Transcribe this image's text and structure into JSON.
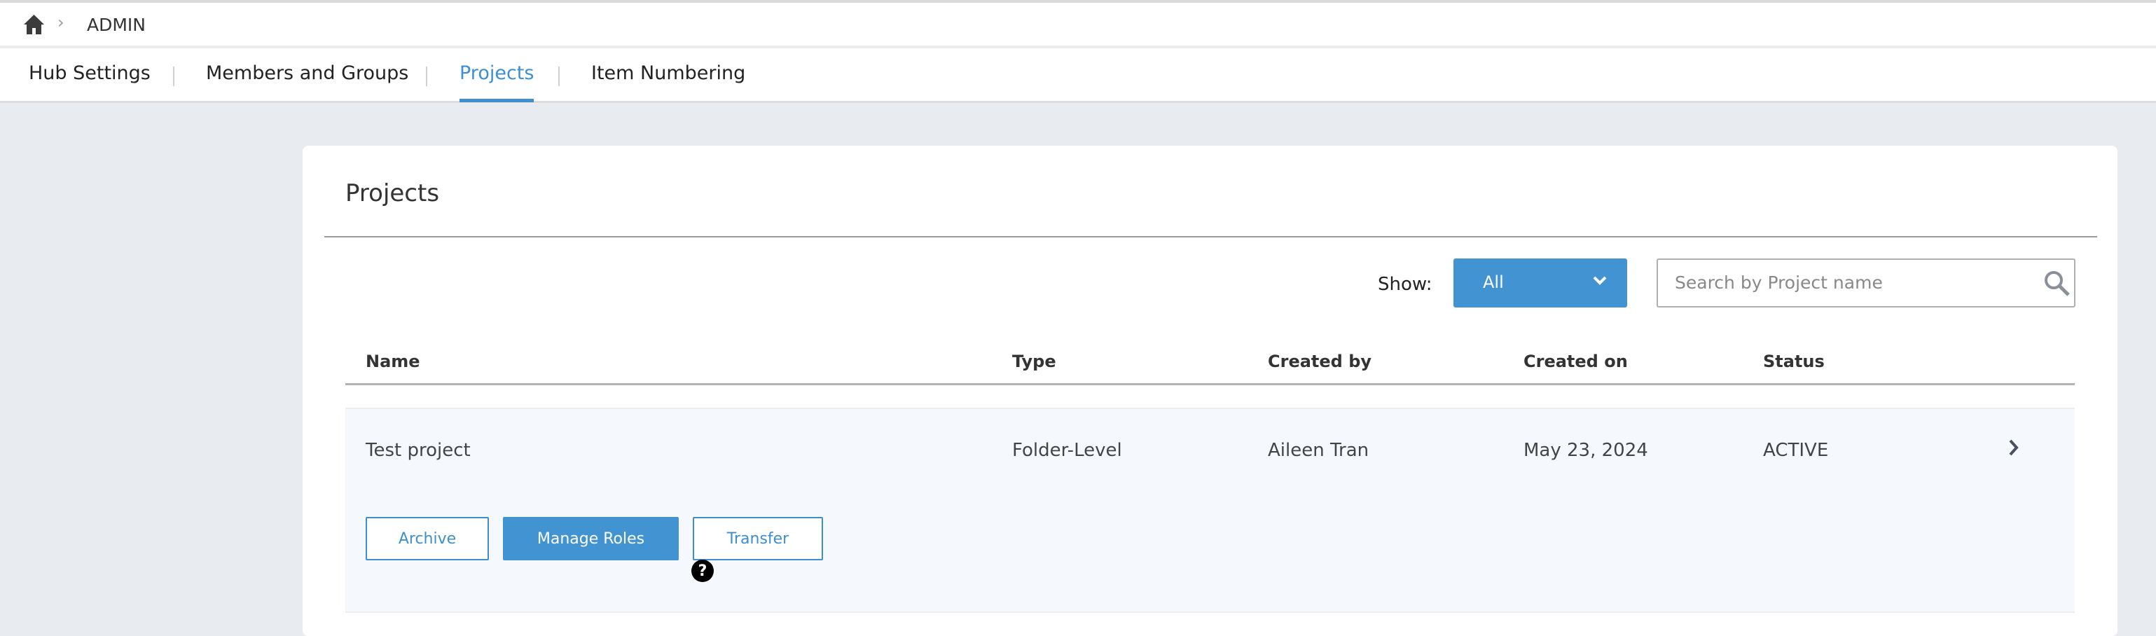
{
  "breadcrumb": {
    "home_icon": "home-icon",
    "label": "ADMIN"
  },
  "tabs": [
    {
      "label": "Hub Settings"
    },
    {
      "label": "Members and Groups"
    },
    {
      "label": "Projects",
      "active": true
    },
    {
      "label": "Item Numbering"
    }
  ],
  "page": {
    "title": "Projects",
    "show_label": "Show:",
    "show_value": "All",
    "search_placeholder": "Search by Project name"
  },
  "table": {
    "headers": [
      "Name",
      "Type",
      "Created by",
      "Created on",
      "Status"
    ],
    "rows": [
      {
        "name": "Test project",
        "type": "Folder-Level",
        "created_by": "Aileen Tran",
        "created_on": "May 23, 2024",
        "status": "ACTIVE"
      }
    ]
  },
  "actions": {
    "archive": "Archive",
    "manage_roles": "Manage Roles",
    "transfer": "Transfer",
    "help": "?"
  },
  "colors": {
    "accent": "#3d8fd1",
    "background": "#e8ebef",
    "row_bg": "#f5f9fd"
  }
}
